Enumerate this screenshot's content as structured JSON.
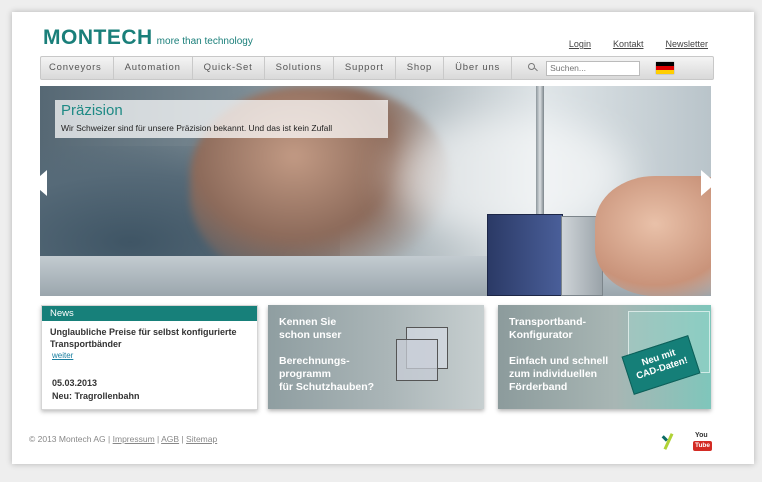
{
  "brand": {
    "logo_text": "MONTECH",
    "tagline": "more than technology"
  },
  "top_links": [
    "Login",
    "Kontakt",
    "Newsletter"
  ],
  "nav": {
    "items": [
      "Conveyors",
      "Automation",
      "Quick-Set",
      "Solutions",
      "Support",
      "Shop",
      "Über uns"
    ],
    "search_placeholder": "Suchen..."
  },
  "hero": {
    "title": "Präzision",
    "text": "Wir Schweizer sind für unsere Präzision bekannt. Und das ist kein Zufall"
  },
  "news": {
    "header": "News",
    "headline": "Unglaubliche Preise für selbst konfigurierte Transportbänder",
    "more_link": "weiter",
    "date": "05.03.2013",
    "item_title": "Neu: Tragrollenbahn"
  },
  "promo_calc": {
    "line1": "Kennen Sie",
    "line2": "schon unser",
    "line3": "Berechnungs-",
    "line4": "programm",
    "line5": "für Schutzhauben?"
  },
  "promo_konf": {
    "line1": "Transportband-",
    "line2": "Konfigurator",
    "line3": "Einfach und schnell",
    "line4": "zum individuellen",
    "line5": "Förderband",
    "badge1": "Neu mit",
    "badge2": "CAD-Daten!"
  },
  "footer": {
    "copyright": "© 2013 Montech AG |",
    "links": [
      "Impressum",
      "AGB",
      "Sitemap"
    ]
  },
  "colors": {
    "brand": "#1a7f7a",
    "news_header": "#17807a"
  },
  "icons": [
    "search-icon",
    "german-flag-icon",
    "xing-icon",
    "youtube-icon",
    "arrow-left-icon",
    "arrow-right-icon"
  ]
}
